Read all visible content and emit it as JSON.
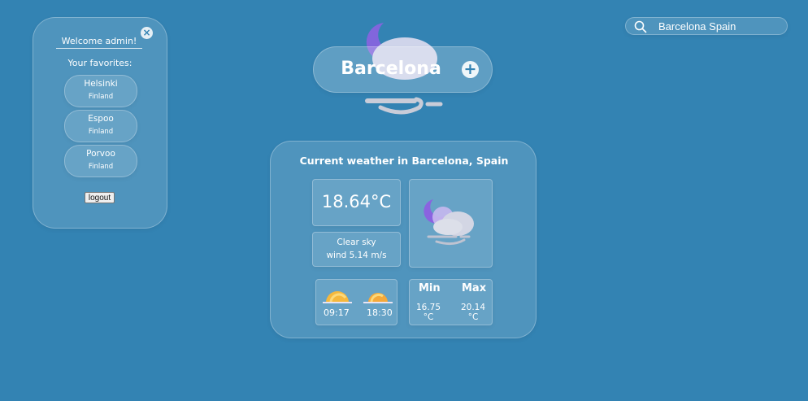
{
  "sidebar": {
    "welcome": "Welcome admin!",
    "favorites_title": "Your favorites:",
    "favorites": [
      {
        "city": "Helsinki",
        "country": "Finland"
      },
      {
        "city": "Espoo",
        "country": "Finland"
      },
      {
        "city": "Porvoo",
        "country": "Finland"
      }
    ],
    "logout_label": "logout",
    "close_icon": "close-icon"
  },
  "search": {
    "value": "Barcelona Spain",
    "icon": "search-icon"
  },
  "header": {
    "city": "Barcelona",
    "add_icon": "plus-icon",
    "weather_icon": "night-cloud-wind-icon"
  },
  "weather": {
    "title": "Current weather in Barcelona, Spain",
    "temperature": "18.64°C",
    "description": "Clear sky",
    "wind": "wind 5.14 m/s",
    "icon": "night-cloud-wind-icon",
    "sunrise": "09:17",
    "sunset": "18:30",
    "sunrise_icon": "sunrise-icon",
    "sunset_icon": "sunset-icon",
    "min_label": "Min",
    "max_label": "Max",
    "min_value": "16.75",
    "max_value": "20.14",
    "min_unit": "°C",
    "max_unit": "°C"
  },
  "colors": {
    "background": "#3383b3",
    "moon": "#8a63e0",
    "sun": "#f5b83d"
  }
}
